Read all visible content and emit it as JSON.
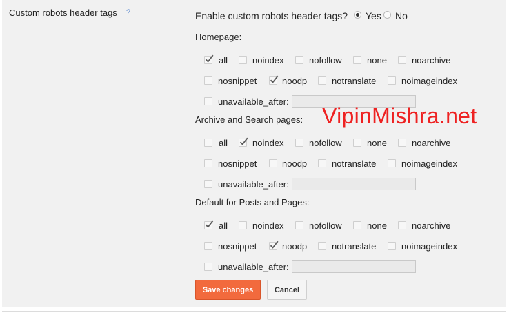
{
  "setting": {
    "label": "Custom robots header tags",
    "help": "?",
    "enable_question": "Enable custom robots header tags?",
    "yes_label": "Yes",
    "no_label": "No",
    "enabled": "yes"
  },
  "watermark": "VipinMishra.net",
  "labels": {
    "all": "all",
    "noindex": "noindex",
    "nofollow": "nofollow",
    "none": "none",
    "noarchive": "noarchive",
    "nosnippet": "nosnippet",
    "noodp": "noodp",
    "notranslate": "notranslate",
    "noimageindex": "noimageindex",
    "unavailable_after": "unavailable_after:"
  },
  "sections": [
    {
      "id": "homepage",
      "title": "Homepage:",
      "checked": {
        "all": true,
        "noindex": false,
        "nofollow": false,
        "none": false,
        "noarchive": false,
        "nosnippet": false,
        "noodp": true,
        "notranslate": false,
        "noimageindex": false,
        "unavailable_after": false
      },
      "unavailable_after_value": ""
    },
    {
      "id": "archive-search",
      "title": "Archive and Search pages:",
      "checked": {
        "all": false,
        "noindex": true,
        "nofollow": false,
        "none": false,
        "noarchive": false,
        "nosnippet": false,
        "noodp": false,
        "notranslate": false,
        "noimageindex": false,
        "unavailable_after": false
      },
      "unavailable_after_value": ""
    },
    {
      "id": "posts-pages",
      "title": "Default for Posts and Pages:",
      "checked": {
        "all": true,
        "noindex": false,
        "nofollow": false,
        "none": false,
        "noarchive": false,
        "nosnippet": false,
        "noodp": true,
        "notranslate": false,
        "noimageindex": false,
        "unavailable_after": false
      },
      "unavailable_after_value": ""
    }
  ],
  "buttons": {
    "save": "Save changes",
    "cancel": "Cancel"
  },
  "colors": {
    "save_button": "#f26a3d",
    "help_link": "#3b73c7",
    "watermark": "#ee2222",
    "panel_bg": "#f1f1f1"
  }
}
